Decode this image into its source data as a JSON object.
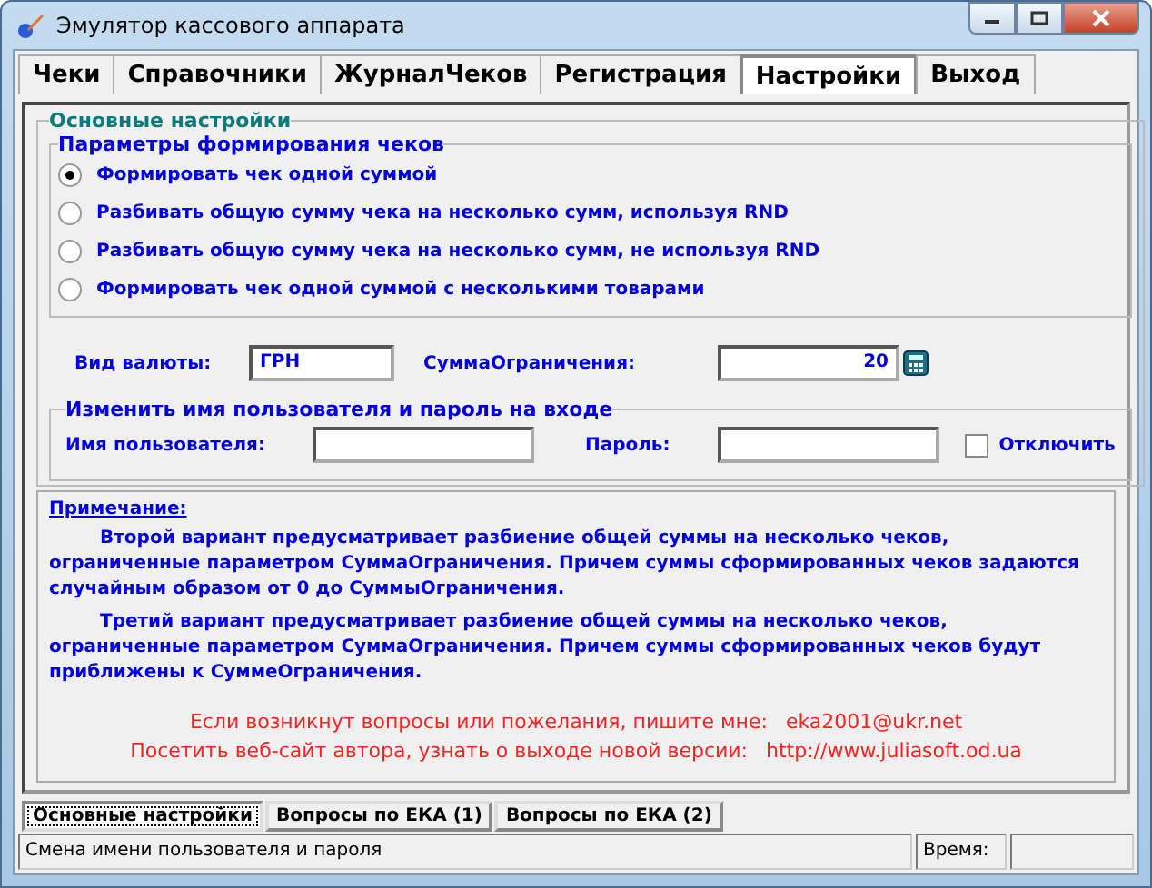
{
  "window": {
    "title": "Эмулятор кассового аппарата"
  },
  "tabs": [
    {
      "label": "Чеки",
      "selected": false
    },
    {
      "label": "Справочники",
      "selected": false
    },
    {
      "label": "ЖурналЧеков",
      "selected": false
    },
    {
      "label": "Регистрация",
      "selected": false
    },
    {
      "label": "Настройки",
      "selected": true
    },
    {
      "label": "Выход",
      "selected": false
    }
  ],
  "settings": {
    "title": "Основные настройки",
    "params": {
      "title": "Параметры формирования чеков",
      "options": [
        {
          "label": "Формировать чек одной суммой",
          "selected": true
        },
        {
          "label": "Разбивать общую сумму чека на несколько сумм, используя RND",
          "selected": false
        },
        {
          "label": "Разбивать общую сумму чека на несколько сумм, не используя RND",
          "selected": false
        },
        {
          "label": "Формировать чек одной суммой с несколькими товарами",
          "selected": false
        }
      ]
    },
    "currency": {
      "label": "Вид валюты:",
      "value": "ГРН"
    },
    "limit": {
      "label": "СуммаОграничения:",
      "value": "20"
    }
  },
  "login": {
    "title": "Изменить имя пользователя и пароль на входе",
    "username_label": "Имя пользователя:",
    "password_label": "Пароль:",
    "disable": {
      "label": "Отключить",
      "checked": false
    }
  },
  "note": {
    "title": "Примечание:",
    "paragraphs": [
      "Второй вариант предусматривает разбиение общей суммы на несколько чеков, ограниченные параметром СуммаОграничения. Причем суммы сформированных чеков задаются случайным образом от 0 до СуммыОграничения.",
      "Третий вариант предусматривает разбиение общей суммы на несколько чеков, ограниченные параметром СуммаОграничения. Причем суммы сформированных чеков будут приближены к СуммеОграничения."
    ],
    "contacts": [
      {
        "text": "Если возникнут вопросы или пожелания, пишите мне:",
        "value": "eka2001@ukr.net"
      },
      {
        "text": "Посетить веб-сайт автора, узнать о выходе новой версии:",
        "value": "http://www.juliasoft.od.ua"
      }
    ]
  },
  "bottom_tabs": [
    {
      "label": "Основные настройки",
      "selected": true
    },
    {
      "label": "Вопросы по ЕКА (1)",
      "selected": false
    },
    {
      "label": "Вопросы по ЕКА (2)",
      "selected": false
    }
  ],
  "status_bar": {
    "message": "Смена имени пользователя и пароля",
    "time_label": "Время:"
  }
}
